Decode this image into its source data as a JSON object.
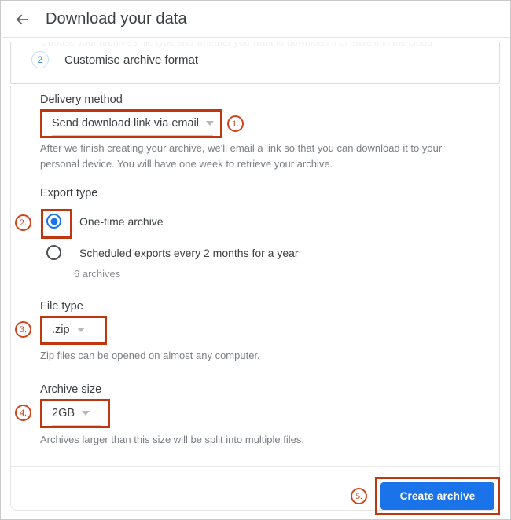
{
  "header": {
    "back_icon": "back-arrow-icon",
    "title": "Download your data"
  },
  "step": {
    "number": "2",
    "title": "Customise archive format",
    "ghost_text": "Choose your archive's file type and whether you want to download it or save it in the cloud"
  },
  "delivery": {
    "label": "Delivery method",
    "value": "Send download link via email",
    "helper": "After we finish creating your archive, we'll email a link so that you can download it to your personal device. You will have one week to retrieve your archive.",
    "annotation": "1."
  },
  "export_type": {
    "label": "Export type",
    "annotation": "2.",
    "options": [
      {
        "label": "One-time archive",
        "selected": true,
        "sub": ""
      },
      {
        "label": "Scheduled exports every 2 months for a year",
        "selected": false,
        "sub": "6 archives"
      }
    ]
  },
  "file_type": {
    "label": "File type",
    "value": ".zip",
    "helper": "Zip files can be opened on almost any computer.",
    "annotation": "3."
  },
  "archive_size": {
    "label": "Archive size",
    "value": "2GB",
    "helper": "Archives larger than this size will be split into multiple files.",
    "annotation": "4."
  },
  "footer": {
    "create_label": "Create archive",
    "annotation": "5."
  },
  "colors": {
    "accent_blue": "#1a73e8",
    "annotation_red": "#c0360f",
    "text_primary": "#3c4043",
    "text_secondary": "#7b7f83"
  }
}
